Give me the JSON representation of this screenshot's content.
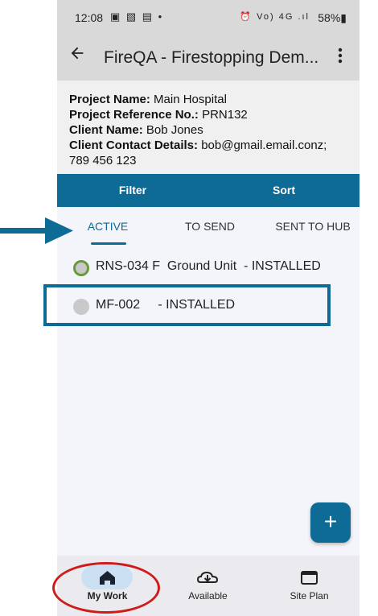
{
  "status_bar": {
    "time": "12:08",
    "left_icons": "▣ ▧ ▤ •",
    "right_icons": "⏰ Vo) 4G .ıl",
    "battery": "58%"
  },
  "app_bar": {
    "title": "FireQA - Firestopping Dem...",
    "back_icon": "arrow-left",
    "overflow_icon": "more-vertical"
  },
  "project": {
    "name_label": "Project Name:",
    "name_value": "Main Hospital",
    "ref_label": "Project Reference No.:",
    "ref_value": "PRN132",
    "client_label": "Client Name:",
    "client_value": "Bob Jones",
    "contact_label": "Client Contact Details:",
    "contact_value": "bob@gmail.email.conz;",
    "contact_value_2": "789 456 123"
  },
  "toolbar": {
    "filter_label": "Filter",
    "sort_label": "Sort"
  },
  "tabs": [
    {
      "label": "ACTIVE",
      "active": true
    },
    {
      "label": "TO SEND",
      "active": false
    },
    {
      "label": "SENT TO HUB",
      "active": false
    }
  ],
  "list": [
    {
      "text": "RNS-034 F  Ground Unit  - INSTALLED",
      "status": "green-ring"
    },
    {
      "text": "MF-002     - INSTALLED",
      "status": "grey"
    }
  ],
  "fab": {
    "label": "+"
  },
  "bottom_nav": [
    {
      "label": "My Work",
      "icon": "home-icon",
      "selected": true
    },
    {
      "label": "Available",
      "icon": "cloud-download-icon",
      "selected": false
    },
    {
      "label": "Site Plan",
      "icon": "window-icon",
      "selected": false
    }
  ],
  "colors": {
    "primary": "#0d6b95",
    "annotation_red": "#d01b1b"
  }
}
